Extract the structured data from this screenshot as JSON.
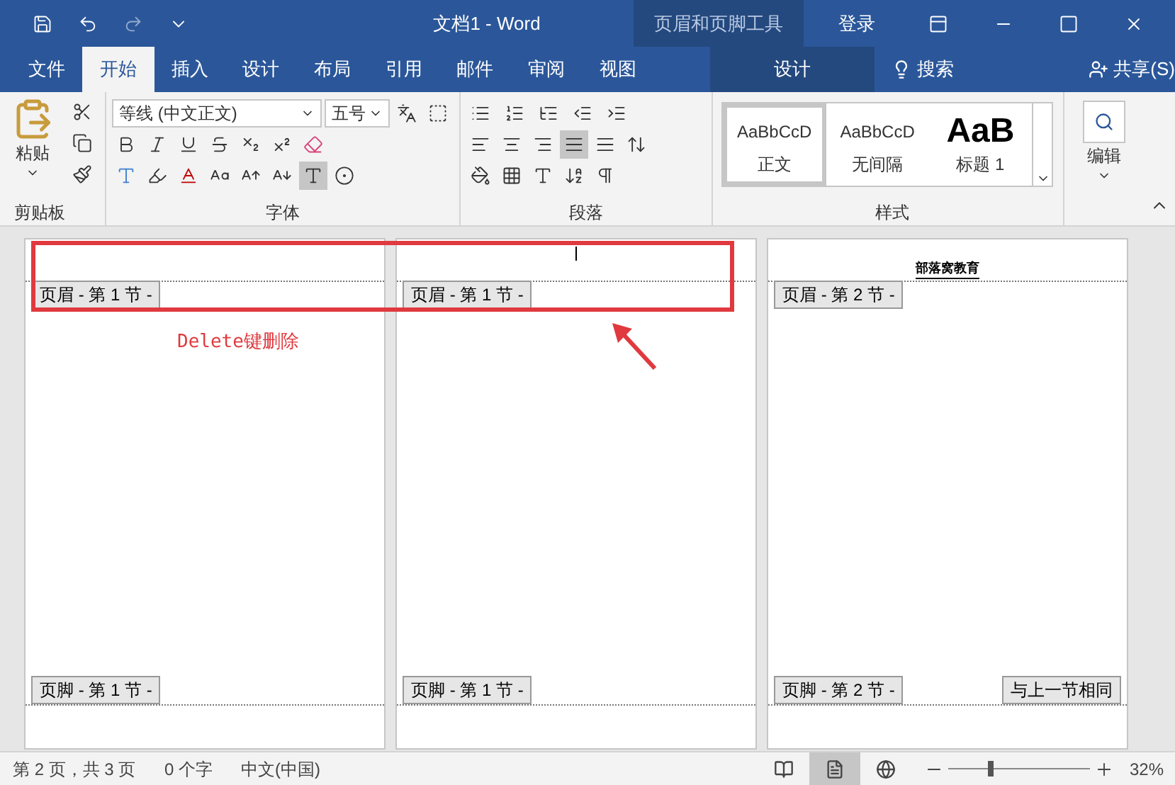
{
  "title_bar": {
    "title": "文档1  -  Word",
    "contextual_tool": "页眉和页脚工具",
    "sign_in": "登录"
  },
  "tabs": [
    {
      "label": "文件",
      "selected": false,
      "kind": "file"
    },
    {
      "label": "开始",
      "selected": true,
      "kind": "normal"
    },
    {
      "label": "插入",
      "selected": false,
      "kind": "normal"
    },
    {
      "label": "设计",
      "selected": false,
      "kind": "normal"
    },
    {
      "label": "布局",
      "selected": false,
      "kind": "normal"
    },
    {
      "label": "引用",
      "selected": false,
      "kind": "normal"
    },
    {
      "label": "邮件",
      "selected": false,
      "kind": "normal"
    },
    {
      "label": "审阅",
      "selected": false,
      "kind": "normal"
    },
    {
      "label": "视图",
      "selected": false,
      "kind": "normal"
    },
    {
      "label": "设计",
      "selected": false,
      "kind": "contextual"
    }
  ],
  "search": {
    "label": "搜索"
  },
  "share": {
    "label": "共享(S)"
  },
  "ribbon": {
    "clipboard": {
      "paste": "粘贴",
      "group": "剪贴板"
    },
    "font": {
      "font_name": "等线 (中文正文)",
      "font_size": "五号",
      "group": "字体"
    },
    "paragraph": {
      "group": "段落",
      "justify_selected": true
    },
    "styles": {
      "group": "样式",
      "items": [
        {
          "preview": "AaBbCcD",
          "name": "正文",
          "kind": "body",
          "selected": true
        },
        {
          "preview": "AaBbCcD",
          "name": "无间隔",
          "kind": "body",
          "selected": false
        },
        {
          "preview": "AaB",
          "name": "标题 1",
          "kind": "heading",
          "selected": false
        }
      ]
    },
    "editing": {
      "label": "编辑"
    }
  },
  "pages": [
    {
      "header_tab": "页眉 - 第 1 节 -",
      "footer_tab": "页脚 - 第 1 节 -",
      "cursor": false
    },
    {
      "header_tab": "页眉 - 第 1 节 -",
      "footer_tab": "页脚 - 第 1 节 -",
      "cursor": true
    },
    {
      "header_tab": "页眉 - 第 2 节 -",
      "footer_tab": "页脚 - 第 2 节 -",
      "cursor": false,
      "header_text": "部落窝教育",
      "footer_badge": "与上一节相同"
    }
  ],
  "annotation": {
    "text": "Delete键删除"
  },
  "status_bar": {
    "page": "第 2 页，共 3 页",
    "words": "0 个字",
    "language": "中文(中国)",
    "view_modes": [
      {
        "kind": "read",
        "selected": false
      },
      {
        "kind": "print",
        "selected": true
      },
      {
        "kind": "web",
        "selected": false
      }
    ],
    "zoom": {
      "level": 0.3,
      "reading": "32%"
    }
  }
}
